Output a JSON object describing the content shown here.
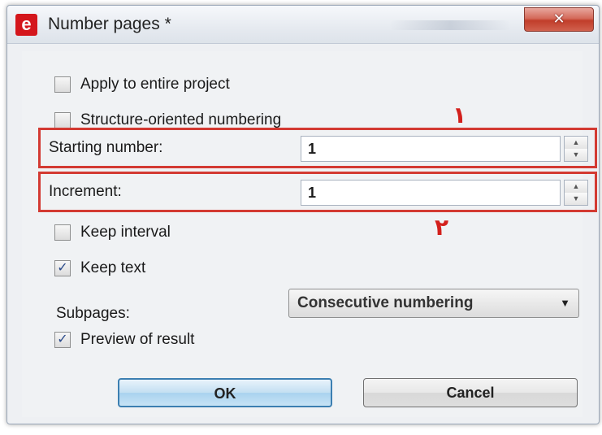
{
  "window": {
    "title": "Number pages *",
    "app_logo_letter": "e",
    "close_glyph": "✕"
  },
  "options": {
    "apply_entire_project": {
      "label": "Apply to entire project",
      "checked": false
    },
    "structure_oriented": {
      "label": "Structure-oriented numbering",
      "checked": false
    },
    "keep_interval": {
      "label": "Keep interval",
      "checked": false
    },
    "keep_text": {
      "label": "Keep text",
      "checked": true
    },
    "preview_result": {
      "label": "Preview of result",
      "checked": true
    }
  },
  "fields": {
    "starting_number": {
      "label": "Starting number:",
      "value": "1"
    },
    "increment": {
      "label": "Increment:",
      "value": "1"
    }
  },
  "subpages": {
    "label": "Subpages:",
    "selected": "Consecutive numbering"
  },
  "annotations": {
    "marker_1": "۱",
    "marker_2": "۲",
    "highlight_color": "#d33a32"
  },
  "buttons": {
    "ok": "OK",
    "cancel": "Cancel"
  },
  "icons": {
    "check": "✓",
    "spin_up": "▲",
    "spin_down": "▼",
    "dropdown": "▼"
  }
}
